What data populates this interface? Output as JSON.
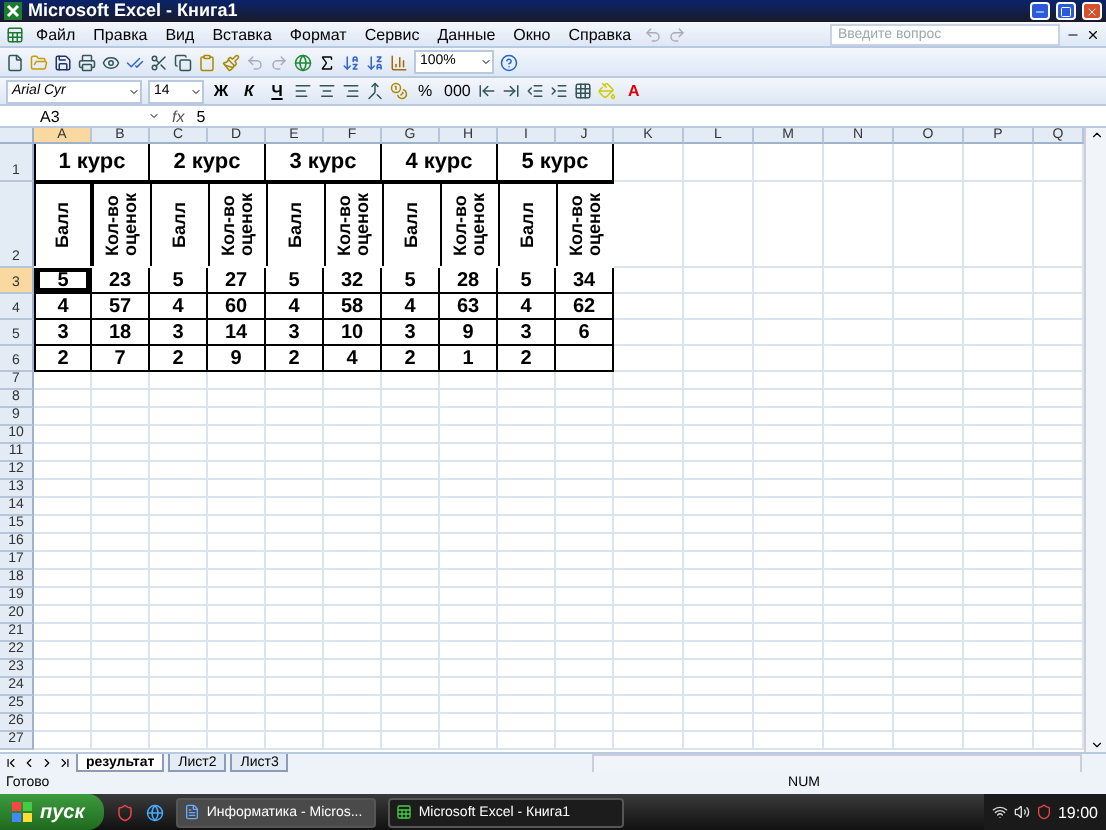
{
  "window": {
    "title": "Microsoft Excel - Книга1"
  },
  "menu": [
    "Файл",
    "Правка",
    "Вид",
    "Вставка",
    "Формат",
    "Сервис",
    "Данные",
    "Окно",
    "Справка"
  ],
  "help_placeholder": "Введите вопрос",
  "toolbar": {
    "zoom": "100%"
  },
  "format_bar": {
    "font": "Arial Cyr",
    "size": "14",
    "bold": "Ж",
    "italic": "К",
    "underline": "Ч",
    "percent": "%",
    "thousands": "000",
    "font_color": "A"
  },
  "formula_bar": {
    "name_box": "A3",
    "function_label": "fx",
    "formula": "5"
  },
  "sheet": {
    "columns": [
      "A",
      "B",
      "C",
      "D",
      "E",
      "F",
      "G",
      "H",
      "I",
      "J",
      "K",
      "L",
      "M",
      "N",
      "O",
      "P",
      "Q"
    ],
    "row_numbers": [
      "1",
      "2",
      "3",
      "4",
      "5",
      "6",
      "7",
      "8",
      "9",
      "10",
      "11",
      "12",
      "13",
      "14",
      "15",
      "16",
      "17",
      "18",
      "19",
      "20",
      "21",
      "22",
      "23",
      "24",
      "25",
      "26",
      "27"
    ],
    "courses": [
      {
        "title": "1 курс",
        "headers": [
          "Балл",
          "Кол-во оценок"
        ]
      },
      {
        "title": "2 курс",
        "headers": [
          "Балл",
          "Кол-во оценок"
        ]
      },
      {
        "title": "3 курс",
        "headers": [
          "Балл",
          "Кол-во оценок"
        ]
      },
      {
        "title": "4 курс",
        "headers": [
          "Балл",
          "Кол-во оценок"
        ]
      },
      {
        "title": "5 курс",
        "headers": [
          "Балл",
          "Кол-во оценок"
        ]
      }
    ],
    "rows": [
      [
        {
          "value": "5",
          "selected": true
        },
        {
          "value": "23",
          "selected": false
        },
        {
          "value": "5",
          "selected": false
        },
        {
          "value": "27",
          "selected": false
        },
        {
          "value": "5",
          "selected": false
        },
        {
          "value": "32",
          "selected": false
        },
        {
          "value": "5",
          "selected": false
        },
        {
          "value": "28",
          "selected": false
        },
        {
          "value": "5",
          "selected": false
        },
        {
          "value": "34",
          "selected": false
        }
      ],
      [
        {
          "value": "4",
          "selected": false
        },
        {
          "value": "57",
          "selected": false
        },
        {
          "value": "4",
          "selected": false
        },
        {
          "value": "60",
          "selected": false
        },
        {
          "value": "4",
          "selected": false
        },
        {
          "value": "58",
          "selected": false
        },
        {
          "value": "4",
          "selected": false
        },
        {
          "value": "63",
          "selected": false
        },
        {
          "value": "4",
          "selected": false
        },
        {
          "value": "62",
          "selected": false
        }
      ],
      [
        {
          "value": "3",
          "selected": false
        },
        {
          "value": "18",
          "selected": false
        },
        {
          "value": "3",
          "selected": false
        },
        {
          "value": "14",
          "selected": false
        },
        {
          "value": "3",
          "selected": false
        },
        {
          "value": "10",
          "selected": false
        },
        {
          "value": "3",
          "selected": false
        },
        {
          "value": "9",
          "selected": false
        },
        {
          "value": "3",
          "selected": false
        },
        {
          "value": "6",
          "selected": false
        }
      ],
      [
        {
          "value": "2",
          "selected": false
        },
        {
          "value": "7",
          "selected": false
        },
        {
          "value": "2",
          "selected": false
        },
        {
          "value": "9",
          "selected": false
        },
        {
          "value": "2",
          "selected": false
        },
        {
          "value": "4",
          "selected": false
        },
        {
          "value": "2",
          "selected": false
        },
        {
          "value": "1",
          "selected": false
        },
        {
          "value": "2",
          "selected": false
        }
      ]
    ]
  },
  "sheet_tabs": [
    {
      "label": "результат",
      "selected": true
    },
    {
      "label": "Лист2",
      "selected": false
    },
    {
      "label": "Лист3",
      "selected": false
    }
  ],
  "status": {
    "left": "Готово",
    "right": "NUM"
  },
  "taskbar": {
    "start": "пуск",
    "tasks": [
      {
        "label": "Информатика - Micros...",
        "selected": false
      },
      {
        "label": "Microsoft Excel - Книга1",
        "selected": true
      }
    ],
    "clock": "19:00"
  }
}
